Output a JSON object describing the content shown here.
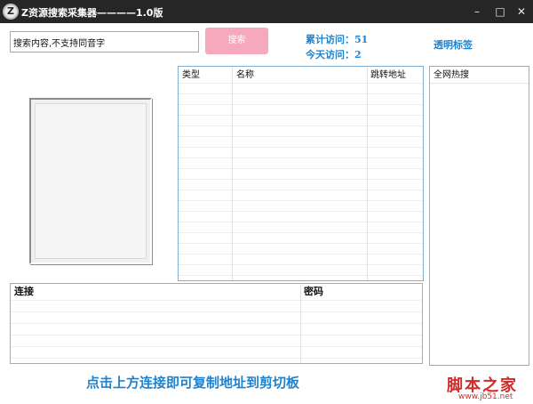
{
  "window": {
    "title": "Z资源搜索采集器————1.0版",
    "icon_letter": "Z",
    "controls": {
      "minimize": "–",
      "maximize": "□",
      "close": "✕"
    }
  },
  "search": {
    "input_value": "搜索内容,不支持同音字",
    "button_label": "搜索"
  },
  "stats": {
    "total_visits": "累计访问：51",
    "today_visits": "今天访问：2"
  },
  "transparent_tag": "透明标签",
  "results_table": {
    "columns": [
      "类型",
      "名称",
      "跳转地址"
    ]
  },
  "links_table": {
    "columns": [
      "连接",
      "密码"
    ]
  },
  "hot_list": {
    "title": "全网热搜"
  },
  "footer_hint": "点击上方连接即可复制地址到剪切板",
  "watermark": {
    "logo": "脚本之家",
    "url": "www.jb51.net"
  },
  "colors": {
    "titlebar": "#262626",
    "accent_blue": "#1e82cf",
    "search_button": "#f6a8bd",
    "watermark_red": "#d02a2a"
  }
}
